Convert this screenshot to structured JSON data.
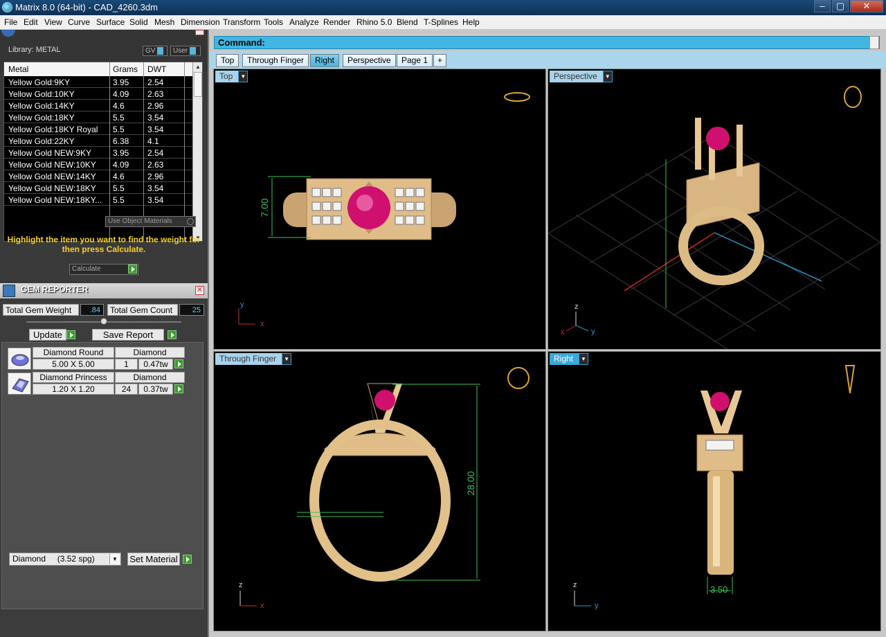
{
  "window": {
    "title": "Matrix 8.0 (64-bit) - CAD_4260.3dm",
    "min": "–",
    "max": "▢",
    "close": "✕"
  },
  "menu": [
    "File",
    "Edit",
    "View",
    "Curve",
    "Surface",
    "Solid",
    "Mesh",
    "Dimension",
    "Transform",
    "Tools",
    "Analyze",
    "Render",
    "Rhino 5.0",
    "Blend",
    "T-Splines",
    "Help"
  ],
  "library": {
    "label": "Library: METAL",
    "gv": "GV",
    "user": "User",
    "columns": [
      "Metal",
      "Grams",
      "DWT"
    ],
    "rows": [
      [
        "Yellow Gold:9KY",
        "3.95",
        "2.54"
      ],
      [
        "Yellow Gold:10KY",
        "4.09",
        "2.63"
      ],
      [
        "Yellow Gold:14KY",
        "4.6",
        "2.96"
      ],
      [
        "Yellow Gold:18KY",
        "5.5",
        "3.54"
      ],
      [
        "Yellow Gold:18KY Royal",
        "5.5",
        "3.54"
      ],
      [
        "Yellow Gold:22KY",
        "6.38",
        "4.1"
      ],
      [
        "Yellow Gold NEW:9KY",
        "3.95",
        "2.54"
      ],
      [
        "Yellow Gold NEW:10KY",
        "4.09",
        "2.63"
      ],
      [
        "Yellow Gold NEW:14KY",
        "4.6",
        "2.96"
      ],
      [
        "Yellow Gold NEW:18KY",
        "5.5",
        "3.54"
      ],
      [
        "Yellow Gold NEW:18KY...",
        "5.5",
        "3.54"
      ]
    ],
    "use_object_materials": "Use Object Materials",
    "hint": "Highlight the item you want to find the weight for then press Calculate.",
    "calculate": "Calculate"
  },
  "gem_reporter": {
    "title": "GEM REPORTER",
    "total_weight_label": "Total Gem Weight",
    "total_weight": ".84",
    "total_count_label": "Total Gem Count",
    "total_count": "25",
    "update": "Update",
    "save_report": "Save Report",
    "gems": [
      {
        "shape": "Diamond Round",
        "material": "Diamond",
        "size": "5.00 X 5.00",
        "count": "1",
        "weight": "0.47tw"
      },
      {
        "shape": "Diamond Princess",
        "material": "Diamond",
        "size": "1.20 X 1.20",
        "count": "24",
        "weight": "0.37tw"
      }
    ],
    "material_select": "Diamond     (3.52 spg)",
    "set_material": "Set Material"
  },
  "command": {
    "label": "Command:"
  },
  "tabs": [
    "Top",
    "Through Finger",
    "Right",
    "Perspective",
    "Page 1",
    "+"
  ],
  "active_tab": "Right",
  "viewports": {
    "top": {
      "label": "Top",
      "dim": "7.00"
    },
    "perspective": {
      "label": "Perspective"
    },
    "through": {
      "label": "Through Finger",
      "dim": "28.00"
    },
    "right": {
      "label": "Right",
      "dim": "3.50"
    }
  },
  "axes": {
    "x": "x",
    "y": "y",
    "z": "z"
  },
  "colors": {
    "accent": "#40b6e0",
    "gold": "#e2c08a",
    "gem": "#d0106e",
    "hint": "#f6d12a",
    "dim": "#3fbf5a"
  }
}
